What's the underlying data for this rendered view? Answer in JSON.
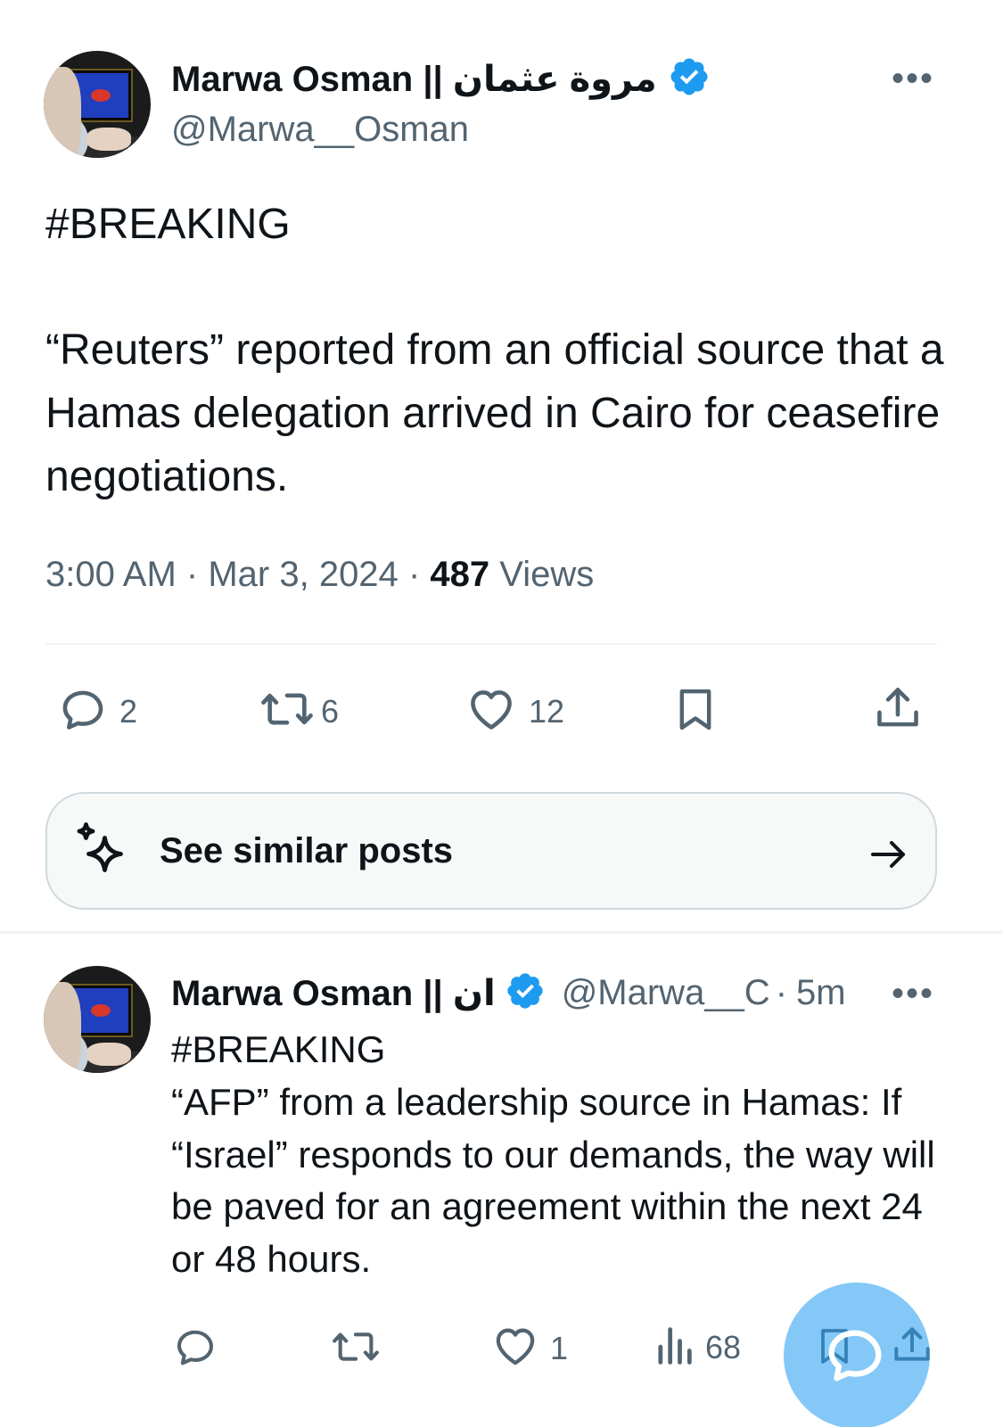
{
  "main_tweet": {
    "author": {
      "display_name": "Marwa Osman || مروة عثمان",
      "handle": "@Marwa__Osman",
      "verified": true
    },
    "more_label": "•••",
    "hashtag": "#BREAKING",
    "body": " “Reuters” reported from an official source that a Hamas delegation arrived in Cairo for ceasefire negotiations.",
    "time": "3:00 AM",
    "separator": "·",
    "date": "Mar 3, 2024",
    "views_count": "487",
    "views_label": "Views",
    "actions": {
      "reply": {
        "icon": "reply-icon",
        "count": "2"
      },
      "retweet": {
        "icon": "retweet-icon",
        "count": "6"
      },
      "like": {
        "icon": "heart-icon",
        "count": "12"
      },
      "bookmark": {
        "icon": "bookmark-icon"
      },
      "share": {
        "icon": "share-icon"
      }
    }
  },
  "see_similar": {
    "label": "See similar posts",
    "icon": "sparkle-icon",
    "arrow_icon": "arrow-right-icon"
  },
  "reply_tweet": {
    "author": {
      "display_name": "Marwa Osman || ان",
      "handle": "@Marwa__C",
      "verified": true
    },
    "separator": "·",
    "age": "5m",
    "more_label": "•••",
    "hashtag": "#BREAKING",
    "body": " “AFP” from a leadership source in Hamas: If “Israel” responds to our demands, the way will be paved for an agreement within the next 24 or 48 hours.",
    "actions": {
      "reply": {
        "icon": "reply-icon",
        "count": ""
      },
      "retweet": {
        "icon": "retweet-icon",
        "count": ""
      },
      "like": {
        "icon": "heart-icon",
        "count": "1"
      },
      "views": {
        "icon": "analytics-icon",
        "count": "68"
      },
      "bookmark": {
        "icon": "bookmark-icon"
      },
      "share": {
        "icon": "share-icon"
      }
    }
  },
  "fab": {
    "icon": "new-reply-icon"
  },
  "colors": {
    "accent": "#1d9bf0",
    "text": "#0f1419",
    "secondary": "#536471",
    "divider": "#eff3f4"
  }
}
